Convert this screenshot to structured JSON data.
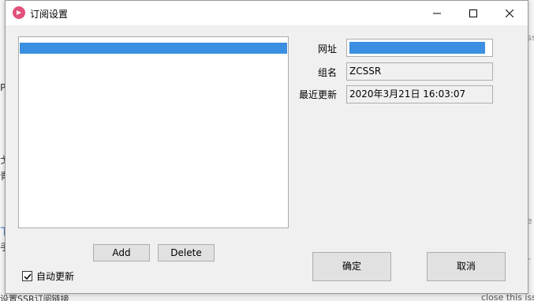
{
  "window": {
    "title": "订阅设置",
    "controls": {
      "minimize": "minimize-icon",
      "maximize": "maximize-icon",
      "close": "close-icon"
    }
  },
  "subscriptions": {
    "items": [
      {
        "label": "",
        "selected": true
      }
    ]
  },
  "buttons": {
    "add_label": "Add",
    "delete_label": "Delete",
    "ok_label": "确定",
    "cancel_label": "取消"
  },
  "auto_update": {
    "label": "自动更新",
    "checked": true
  },
  "fields": {
    "url_label": "网址",
    "url_value": "",
    "group_label": "组名",
    "group_value": "ZCSSR",
    "updated_label": "最近更新",
    "updated_value": "2020年3月21日 16:03:07"
  },
  "background_fragments": {
    "left_1": "戈",
    "left_2": "青",
    "left_3": "P",
    "left_4": "下",
    "left_5": "手",
    "bottom_left": "设置SSR订阅链接",
    "right_1": "ss",
    "right_2": "e",
    "right_3": "r",
    "bottom_right": "close this issu"
  },
  "colors": {
    "selection": "#3b8fe0",
    "app_icon": "#e0527a"
  }
}
